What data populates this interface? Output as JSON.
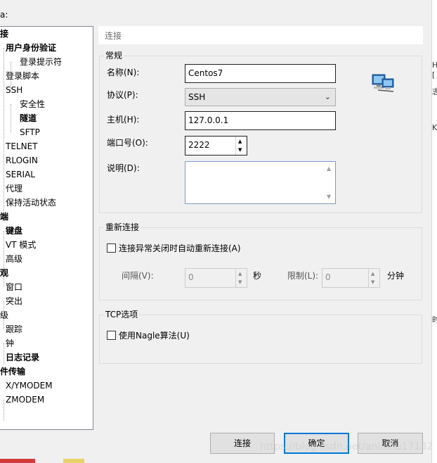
{
  "window": {
    "title_fragment": "a:"
  },
  "tree": {
    "items": [
      {
        "label": "接",
        "bold": true
      },
      {
        "label": "用户身份验证",
        "bold": true
      },
      {
        "label": "登录提示符",
        "bold": false
      },
      {
        "label": "登录脚本",
        "bold": false
      },
      {
        "label": "SSH",
        "bold": false
      },
      {
        "label": "安全性",
        "bold": false
      },
      {
        "label": "隧道",
        "bold": true
      },
      {
        "label": "SFTP",
        "bold": false
      },
      {
        "label": "TELNET",
        "bold": false
      },
      {
        "label": "RLOGIN",
        "bold": false
      },
      {
        "label": "SERIAL",
        "bold": false
      },
      {
        "label": "代理",
        "bold": false
      },
      {
        "label": "保持活动状态",
        "bold": false
      },
      {
        "label": "端",
        "bold": true
      },
      {
        "label": "键盘",
        "bold": true
      },
      {
        "label": "VT 模式",
        "bold": false
      },
      {
        "label": "高级",
        "bold": false
      },
      {
        "label": "观",
        "bold": true
      },
      {
        "label": "窗口",
        "bold": false
      },
      {
        "label": "突出",
        "bold": false
      },
      {
        "label": "级",
        "bold": false
      },
      {
        "label": "跟踪",
        "bold": false
      },
      {
        "label": "钟",
        "bold": false
      },
      {
        "label": "日志记录",
        "bold": true
      },
      {
        "label": "件传输",
        "bold": true
      },
      {
        "label": "X/YMODEM",
        "bold": false
      },
      {
        "label": "ZMODEM",
        "bold": false
      }
    ]
  },
  "page": {
    "section_title": "连接"
  },
  "general": {
    "group_label": "常规",
    "name_label": "名称(N):",
    "name_value": "Centos7",
    "protocol_label": "协议(P):",
    "protocol_value": "SSH",
    "host_label": "主机(H):",
    "host_value": "127.0.0.1",
    "port_label": "端口号(O):",
    "port_value": "2222",
    "desc_label": "说明(D):",
    "desc_value": "",
    "icon": "network-computer-icon"
  },
  "reconnect": {
    "group_label": "重新连接",
    "auto_reconnect_label": "连接异常关闭时自动重新连接(A)",
    "auto_reconnect_checked": false,
    "interval_label": "间隔(V):",
    "interval_value": "0",
    "interval_unit": "秒",
    "limit_label": "限制(L):",
    "limit_value": "0",
    "limit_unit": "分钟"
  },
  "tcp": {
    "group_label": "TCP选项",
    "nagle_label": "使用Nagle算法(U)",
    "nagle_checked": false
  },
  "buttons": {
    "connect": "连接",
    "ok": "确定",
    "cancel": "取消"
  },
  "watermark": "https://blog.csdn.net/anlinhu17132",
  "right_strip": {
    "marks": [
      "H",
      "[",
      "志",
      "K",
      "时"
    ]
  },
  "colors": {
    "default_button_border": "#0078d7",
    "desc_border": "#7a9cc6"
  }
}
